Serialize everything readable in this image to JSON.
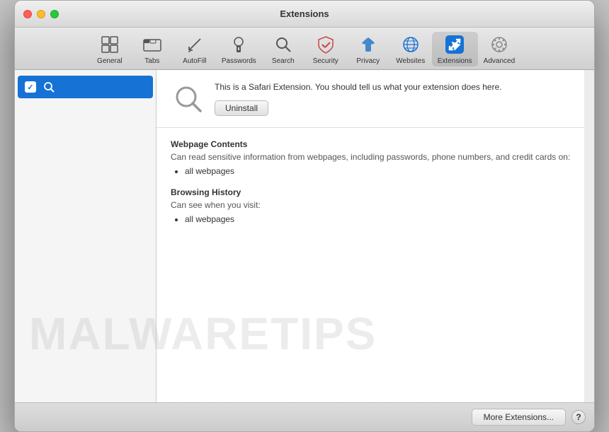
{
  "window": {
    "title": "Extensions"
  },
  "toolbar": {
    "items": [
      {
        "id": "general",
        "label": "General",
        "icon": "⊞"
      },
      {
        "id": "tabs",
        "label": "Tabs",
        "icon": "▣"
      },
      {
        "id": "autofill",
        "label": "AutoFill",
        "icon": "✎"
      },
      {
        "id": "passwords",
        "label": "Passwords",
        "icon": "🔑"
      },
      {
        "id": "search",
        "label": "Search",
        "icon": "🔍"
      },
      {
        "id": "security",
        "label": "Security",
        "icon": "🔒"
      },
      {
        "id": "privacy",
        "label": "Privacy",
        "icon": "✋"
      },
      {
        "id": "websites",
        "label": "Websites",
        "icon": "🌐"
      },
      {
        "id": "extensions",
        "label": "Extensions",
        "icon": "⚡",
        "active": true
      },
      {
        "id": "advanced",
        "label": "Advanced",
        "icon": "⚙"
      }
    ]
  },
  "sidebar": {
    "items": [
      {
        "id": "search-extension",
        "label": "",
        "checked": true,
        "selected": true
      }
    ]
  },
  "detail": {
    "description": "This is a Safari Extension. You should tell us what your extension does here.",
    "uninstall_label": "Uninstall",
    "permissions": [
      {
        "title": "Webpage Contents",
        "desc": "Can read sensitive information from webpages, including passwords, phone numbers, and credit cards on:",
        "items": [
          "all webpages"
        ]
      },
      {
        "title": "Browsing History",
        "desc": "Can see when you visit:",
        "items": [
          "all webpages"
        ]
      }
    ]
  },
  "footer": {
    "more_extensions_label": "More Extensions...",
    "help_label": "?"
  },
  "watermark": {
    "text": "MALWARETIPS"
  }
}
